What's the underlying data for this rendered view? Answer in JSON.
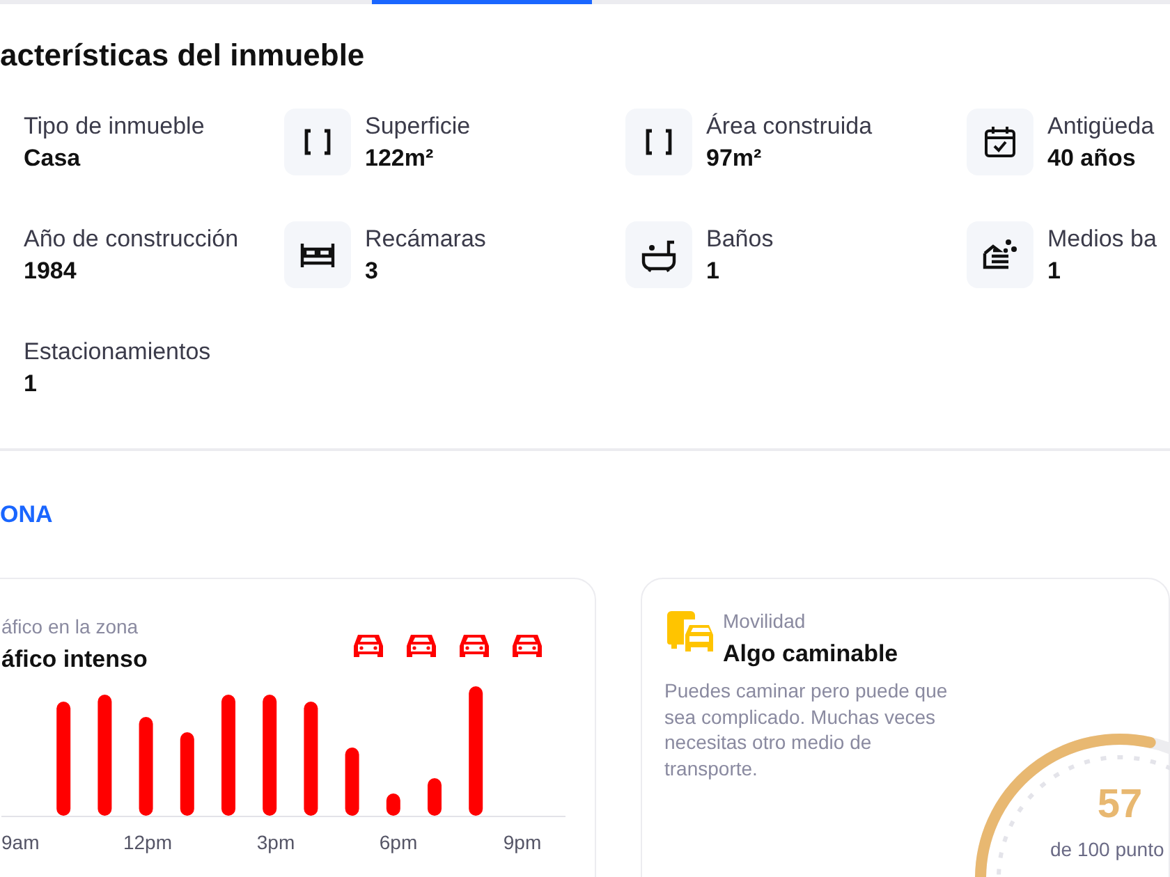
{
  "tabs_underline": {
    "selected": true
  },
  "features": {
    "title": "acterísticas del inmueble",
    "items": [
      {
        "label": "Tipo de inmueble",
        "value": "Casa"
      },
      {
        "label": "Superficie",
        "value": "122m²"
      },
      {
        "label": "Área construida",
        "value": "97m²"
      },
      {
        "label": "Antigüeda",
        "value": "40 años"
      },
      {
        "label": "Año de construcción",
        "value": "1984"
      },
      {
        "label": "Recámaras",
        "value": "3"
      },
      {
        "label": "Baños",
        "value": "1"
      },
      {
        "label": "Medios ba",
        "value": "1"
      },
      {
        "label": "Estacionamientos",
        "value": "1"
      }
    ]
  },
  "zone": {
    "title": "ONA",
    "traffic": {
      "label": "áfico en la zona",
      "status": "áfico intenso",
      "x_labels": [
        "9am",
        "12pm",
        "3pm",
        "6pm",
        "9pm"
      ]
    },
    "mobility": {
      "label": "Movilidad",
      "status": "Algo caminable",
      "description": "Puedes caminar pero puede que sea complicado. Muchas veces necesitas otro medio de transporte.",
      "score": "57",
      "score_caption": "de 100 punto",
      "level": 0.57
    }
  }
}
